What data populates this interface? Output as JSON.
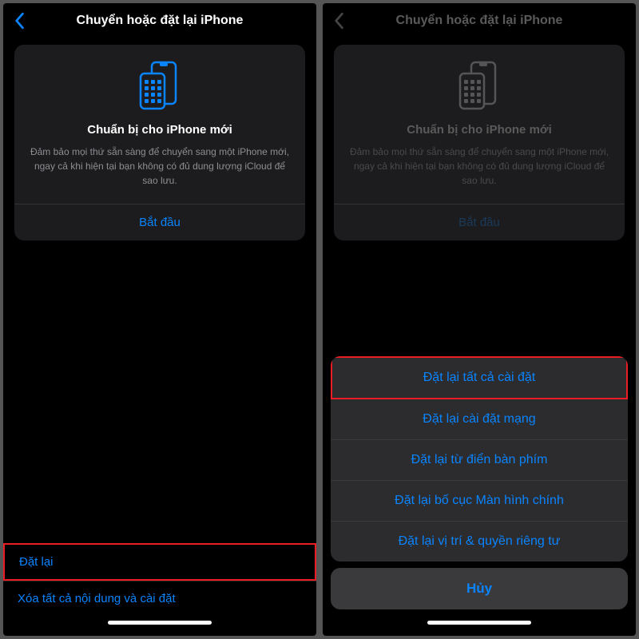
{
  "screen1": {
    "header": {
      "title": "Chuyển hoặc đặt lại iPhone",
      "back_color": "#0a84ff"
    },
    "card": {
      "title": "Chuẩn bị cho iPhone mới",
      "description": "Đảm bảo mọi thứ sẵn sàng để chuyển sang một iPhone mới, ngay cả khi hiện tại bạn không có đủ dung lượng iCloud để sao lưu.",
      "action": "Bắt đầu",
      "icon_color": "#0a84ff"
    },
    "bottom": {
      "reset": "Đặt lại",
      "erase": "Xóa tất cả nội dung và cài đặt"
    }
  },
  "screen2": {
    "header": {
      "title": "Chuyển hoặc đặt lại iPhone",
      "back_color": "#444"
    },
    "card": {
      "title": "Chuẩn bị cho iPhone mới",
      "description": "Đảm bảo mọi thứ sẵn sàng để chuyển sang một iPhone mới, ngay cả khi hiện tại bạn không có đủ dung lượng iCloud để sao lưu.",
      "action": "Bắt đầu",
      "icon_color": "#555"
    },
    "sheet": {
      "options": [
        "Đặt lại tất cả cài đặt",
        "Đặt lại cài đặt mạng",
        "Đặt lại từ điển bàn phím",
        "Đặt lại bố cục Màn hình chính",
        "Đặt lại vị trí & quyền riêng tư"
      ],
      "cancel": "Hủy"
    }
  }
}
